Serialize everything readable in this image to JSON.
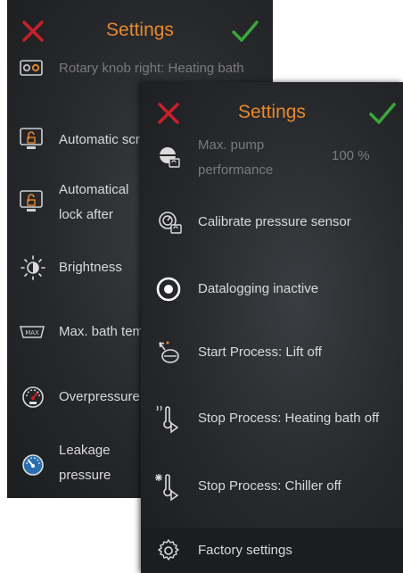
{
  "back_panel": {
    "title": "Settings",
    "items": [
      {
        "label": "Rotary knob right: Heating bath",
        "icon": "rotary-knob-icon"
      },
      {
        "label": "Automatic scr",
        "icon": "screen-lock-icon"
      },
      {
        "label": "Automatical",
        "label2": "lock after",
        "icon": "screen-lock-icon"
      },
      {
        "label": "Brightness",
        "icon": "brightness-icon"
      },
      {
        "label": "Max. bath tem",
        "icon": "max-temp-icon",
        "badge": "MAX"
      },
      {
        "label": "Overpressure",
        "icon": "overpressure-gauge-icon"
      },
      {
        "label": "Leakage",
        "label2": "pressure",
        "icon": "leakage-gauge-icon"
      }
    ]
  },
  "front_panel": {
    "title": "Settings",
    "items": [
      {
        "label": "Max. pump",
        "label2": "performance",
        "value": "100 %",
        "icon": "pump-icon"
      },
      {
        "label": "Calibrate pressure sensor",
        "icon": "calibrate-sensor-icon"
      },
      {
        "label": "Datalogging inactive",
        "icon": "record-icon"
      },
      {
        "label": "Start Process: Lift off",
        "icon": "lift-off-icon"
      },
      {
        "label": "Stop Process: Heating bath off",
        "icon": "heating-bath-off-icon"
      },
      {
        "label": "Stop Process: Chiller off",
        "icon": "chiller-off-icon"
      },
      {
        "label": "Factory settings",
        "icon": "gear-icon"
      }
    ]
  },
  "colors": {
    "title": "#e8882d",
    "cancel": "#c8202a",
    "confirm": "#3aa83a",
    "text": "#d9d9d9"
  }
}
